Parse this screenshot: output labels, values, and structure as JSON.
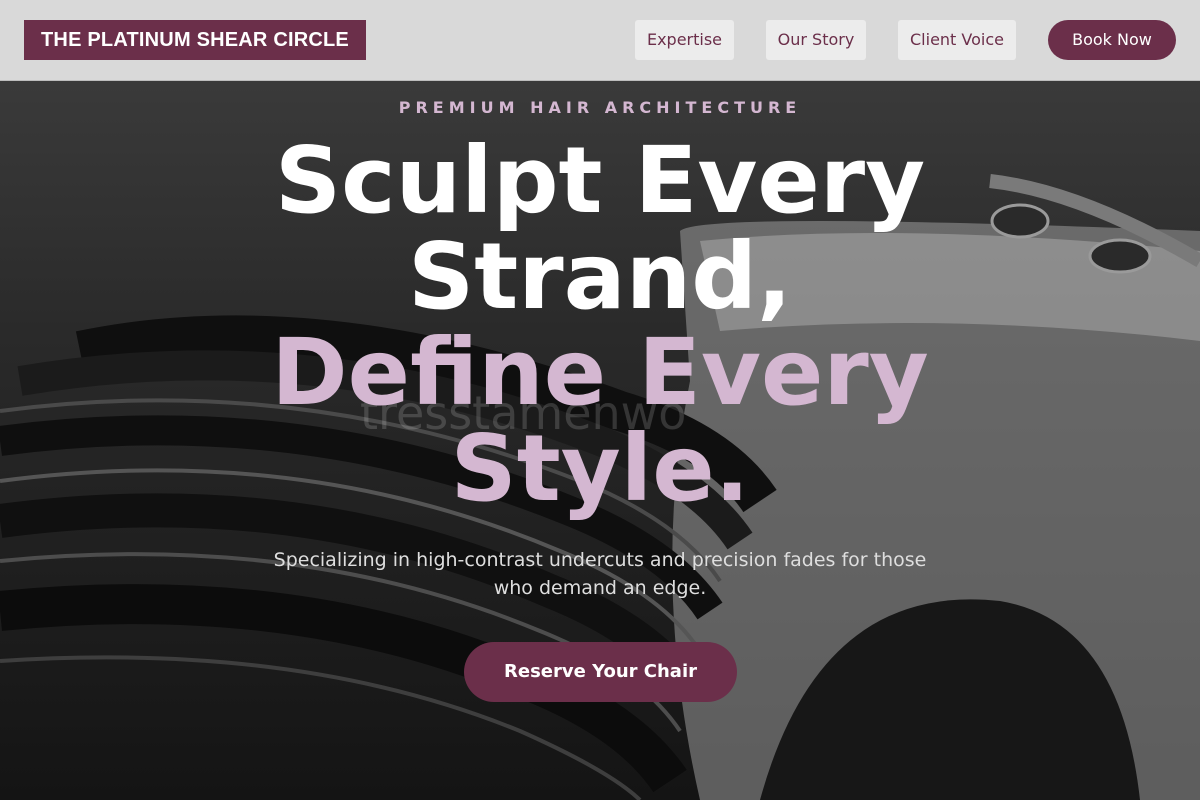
{
  "header": {
    "logo_text": "THE PLATINUM SHEAR CIRCLE",
    "nav": {
      "expertise": "Expertise",
      "our_story": "Our Story",
      "client_voice": "Client Voice"
    },
    "book_button": "Book Now"
  },
  "hero": {
    "eyebrow": "PREMIUM HAIR ARCHITECTURE",
    "headline_line1": "Sculpt Every",
    "headline_line2": "Strand,",
    "headline_line3": "Define Every",
    "headline_line4": "Style.",
    "subtitle": "Specializing in high-contrast undercuts and precision fades for those who demand an edge.",
    "cta": "Reserve Your Chair",
    "background_watermark": "tresstamenwo"
  },
  "colors": {
    "brand": "#6b2f4a",
    "accent": "#d4b7d1",
    "header_bg": "#d9d9d9"
  }
}
